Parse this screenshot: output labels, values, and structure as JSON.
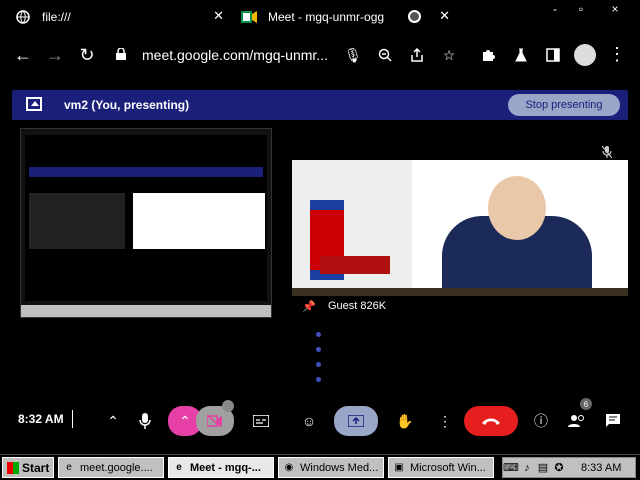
{
  "browser": {
    "tabs": [
      {
        "label": "file:///",
        "icon": "globe-icon"
      },
      {
        "label": "Meet - mgq-unmr-ogg",
        "icon": "meet-icon"
      }
    ],
    "url": "meet.google.com/mgq-unmr...",
    "window_controls": [
      "-",
      "▫",
      "×"
    ]
  },
  "meet": {
    "banner_title": "vm2 (You, presenting)",
    "stop_presenting_label": "Stop presenting",
    "guest_name": "Guest 826K",
    "clock": "8:32 AM",
    "participant_count": "6"
  },
  "taskbar": {
    "start_label": "Start",
    "items": [
      {
        "label": "meet.google....",
        "icon": "ie-icon"
      },
      {
        "label": "Meet - mgq-...",
        "icon": "ie-icon"
      },
      {
        "label": "Windows Med...",
        "icon": "chrome-icon"
      },
      {
        "label": "Microsoft Win...",
        "icon": "mmc-icon"
      }
    ],
    "clock": "8:33 AM"
  },
  "colors": {
    "banner": "#1a1f7a",
    "end_call": "#e61e1e",
    "mic_camera": "#e63fa6",
    "present": "#9aa6c8"
  }
}
